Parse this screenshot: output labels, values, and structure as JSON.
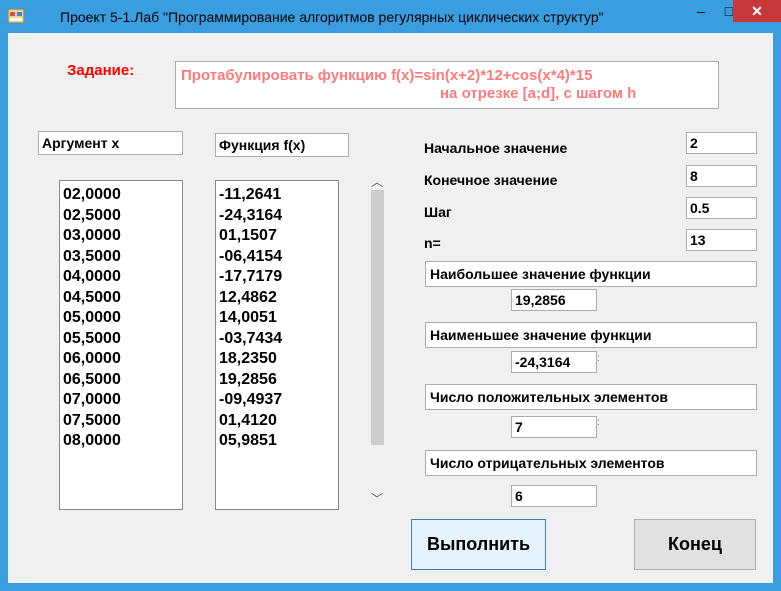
{
  "window": {
    "title": "Проект 5-1.Лаб \"Программирование алгоритмов регулярных циклических  структур\"",
    "controls": {
      "minimize": "–",
      "maximize": "□",
      "close": "✕"
    }
  },
  "task": {
    "label": "Задание:",
    "line1": "Протабулировать функцию f(x)=sin(x+2)*12+cos(x*4)*15",
    "line2": "на отрезке [a;d], с шагом h"
  },
  "columns": {
    "argument_header": "Аргумент x",
    "function_header": "Функция f(x)"
  },
  "arguments": [
    "02,0000",
    "02,5000",
    "03,0000",
    "03,5000",
    "04,0000",
    "04,5000",
    "05,0000",
    "05,5000",
    "06,0000",
    "06,5000",
    "07,0000",
    "07,5000",
    "08,0000"
  ],
  "function_values": [
    "-11,2641",
    "-24,3164",
    "01,1507",
    "-06,4154",
    "-17,7179",
    "12,4862",
    "14,0051",
    "-03,7434",
    "18,2350",
    "19,2856",
    "-09,4937",
    "01,4120",
    "05,9851"
  ],
  "params": {
    "start_label": "Начальное значение",
    "start_value": "2",
    "end_label": "Конечное значение",
    "end_value": "8",
    "step_label": "Шаг",
    "step_value": "0.5",
    "n_label": "n=",
    "n_value": "13"
  },
  "results": {
    "max_label": "Наибольшее значение функции",
    "max_value": "19,2856",
    "min_label": "Наименьшее значение функции",
    "min_value": "-24,3164",
    "pos_label": "Число положительных элементов",
    "pos_value": "7",
    "neg_label": "Число отрицательных элементов",
    "neg_value": "6"
  },
  "buttons": {
    "run": "Выполнить",
    "end": "Конец"
  },
  "colors": {
    "titlebar": "#3a9de0",
    "task_label": "#ff0000",
    "task_text": "#ff7a7a",
    "close": "#c7383a"
  }
}
